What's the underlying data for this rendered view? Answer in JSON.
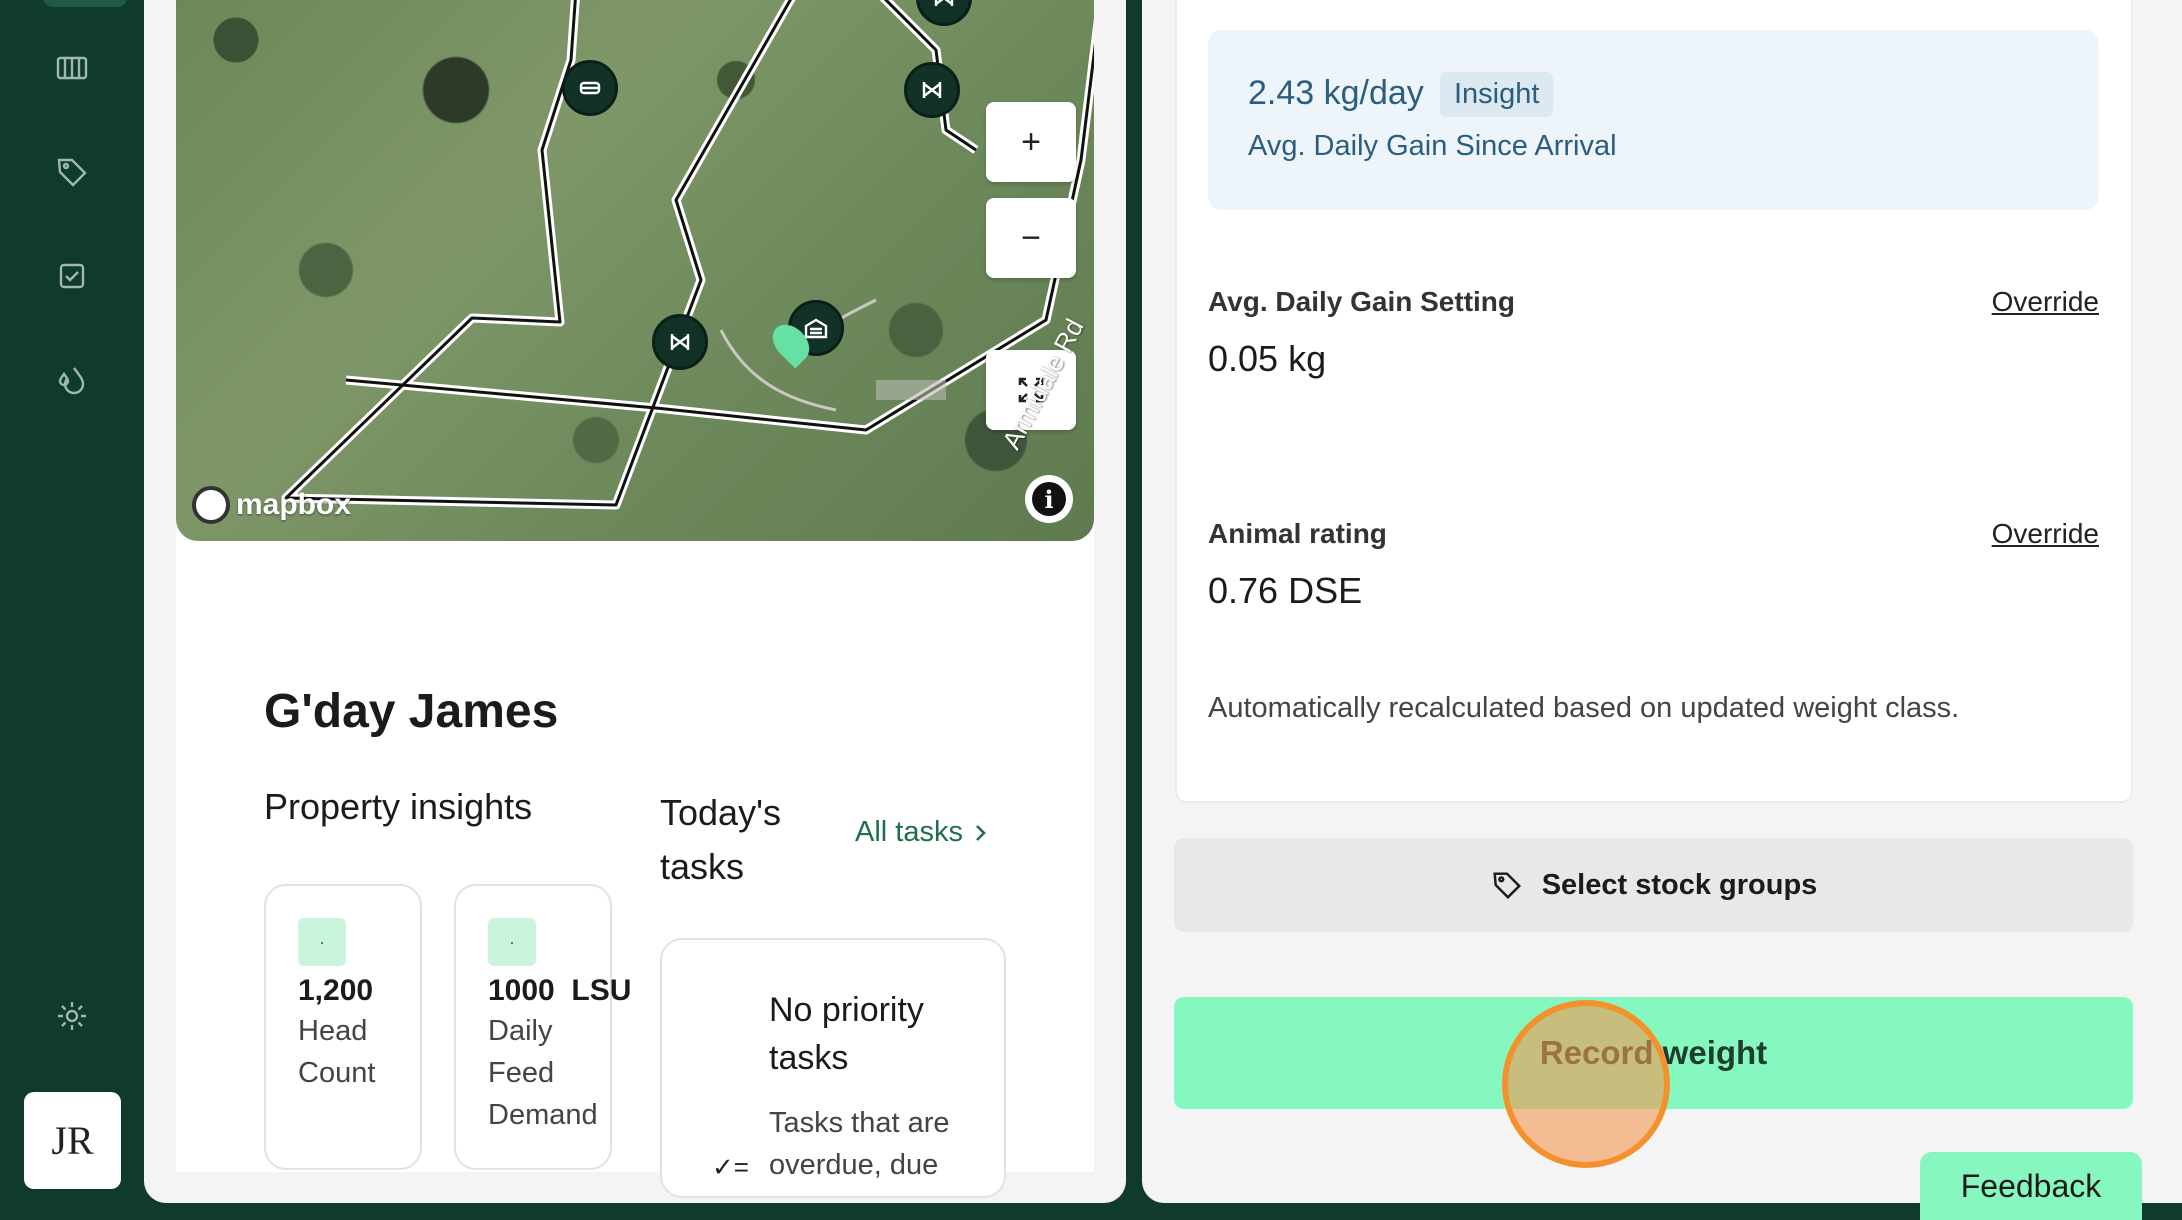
{
  "sidebar": {
    "items": [
      {
        "icon": "paddocks-icon"
      },
      {
        "icon": "tag-icon"
      },
      {
        "icon": "tasks-checkbox-icon"
      },
      {
        "icon": "water-drops-icon"
      }
    ],
    "settings_icon": "gear-icon",
    "avatar_initials": "JR"
  },
  "map": {
    "attribution": "mapbox",
    "road_label": "Armidale Rd",
    "zoom_in": "+",
    "zoom_out": "−",
    "info": "i"
  },
  "home": {
    "greeting": "G'day James",
    "insights_title": "Property insights",
    "tasks_title": "Today's tasks",
    "all_tasks_label": "All tasks",
    "stats": [
      {
        "value": "1,200",
        "unit": "",
        "label": "Head Count"
      },
      {
        "value": "1000",
        "unit": "LSU",
        "label": "Daily Feed Demand"
      }
    ],
    "no_tasks_title": "No priority tasks",
    "no_tasks_desc": "Tasks that are overdue, due"
  },
  "panel": {
    "insight_value": "2.43 kg/day",
    "insight_badge": "Insight",
    "insight_caption": "Avg. Daily Gain Since Arrival",
    "adg_label": "Avg. Daily Gain Setting",
    "adg_value": "0.05 kg",
    "rating_label": "Animal rating",
    "rating_value": "0.76 DSE",
    "override_label": "Override",
    "recalc_note": "Automatically recalculated based on updated weight class.",
    "select_groups_label": "Select stock groups",
    "record_weight_label": "Record weight"
  },
  "feedback_label": "Feedback",
  "colors": {
    "sidebar_bg": "#0f3a2c",
    "primary_button": "#86f7bf",
    "insight_text": "#2b5d80",
    "link_green": "#1f6f4a",
    "click_marker": "#f3922c"
  }
}
